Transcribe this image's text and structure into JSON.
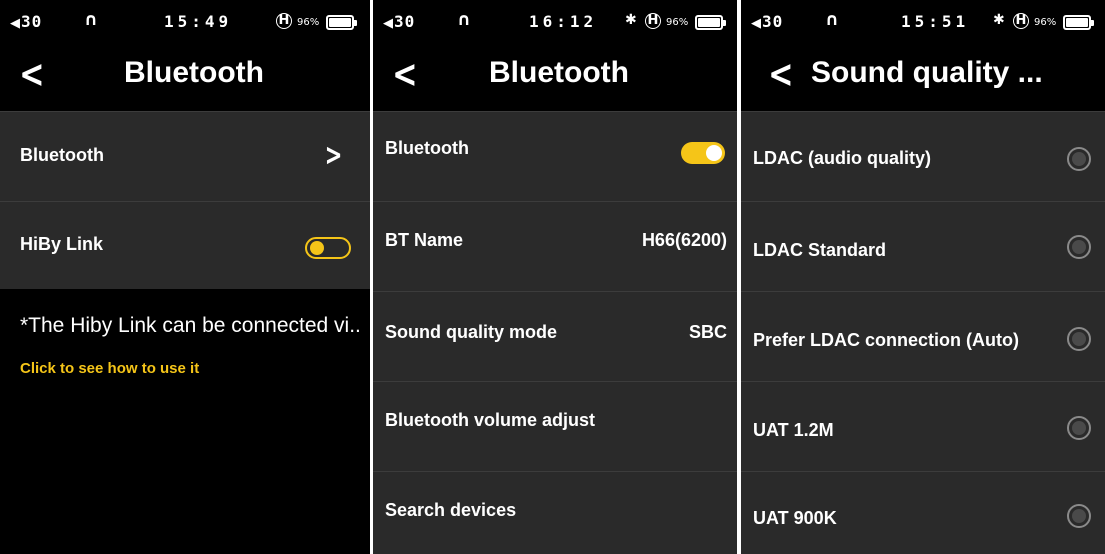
{
  "accent_color": "#f5c518",
  "screen1": {
    "status": {
      "volume": "30",
      "time": "15:49",
      "battery_pct": "96%",
      "battery_level": 0.96,
      "icons": [
        "speaker-icon",
        "headphone-icon",
        "hiby-icon",
        "battery-icon"
      ]
    },
    "back_icon": "<",
    "title": "Bluetooth",
    "rows": [
      {
        "label": "Bluetooth",
        "chevron": ">"
      },
      {
        "label": "HiBy Link",
        "toggle": "off"
      }
    ],
    "note": "*The Hiby Link can be connected vi..",
    "link": "Click to see how to use it"
  },
  "screen2": {
    "status": {
      "volume": "30",
      "time": "16:12",
      "battery_pct": "96%",
      "battery_level": 0.96,
      "icons": [
        "speaker-icon",
        "headphone-icon",
        "bluetooth-icon",
        "hiby-icon",
        "battery-icon"
      ]
    },
    "back_icon": "<",
    "title": "Bluetooth",
    "rows": [
      {
        "label": "Bluetooth",
        "toggle": "on"
      },
      {
        "label": "BT Name",
        "value": "H66(6200)"
      },
      {
        "label": "Sound quality mode",
        "value": "SBC"
      },
      {
        "label": "Bluetooth volume adjust"
      },
      {
        "label": "Search devices"
      }
    ]
  },
  "screen3": {
    "status": {
      "volume": "30",
      "time": "15:51",
      "battery_pct": "96%",
      "battery_level": 0.96,
      "icons": [
        "speaker-icon",
        "headphone-icon",
        "bluetooth-icon",
        "hiby-icon",
        "battery-icon"
      ]
    },
    "back_icon": "<",
    "title": "Sound quality ...",
    "options": [
      {
        "label": "LDAC (audio quality)",
        "selected": false
      },
      {
        "label": "LDAC Standard",
        "selected": false
      },
      {
        "label": "Prefer LDAC connection (Auto)",
        "selected": false
      },
      {
        "label": "UAT 1.2M",
        "selected": false
      },
      {
        "label": "UAT 900K",
        "selected": false
      }
    ]
  }
}
